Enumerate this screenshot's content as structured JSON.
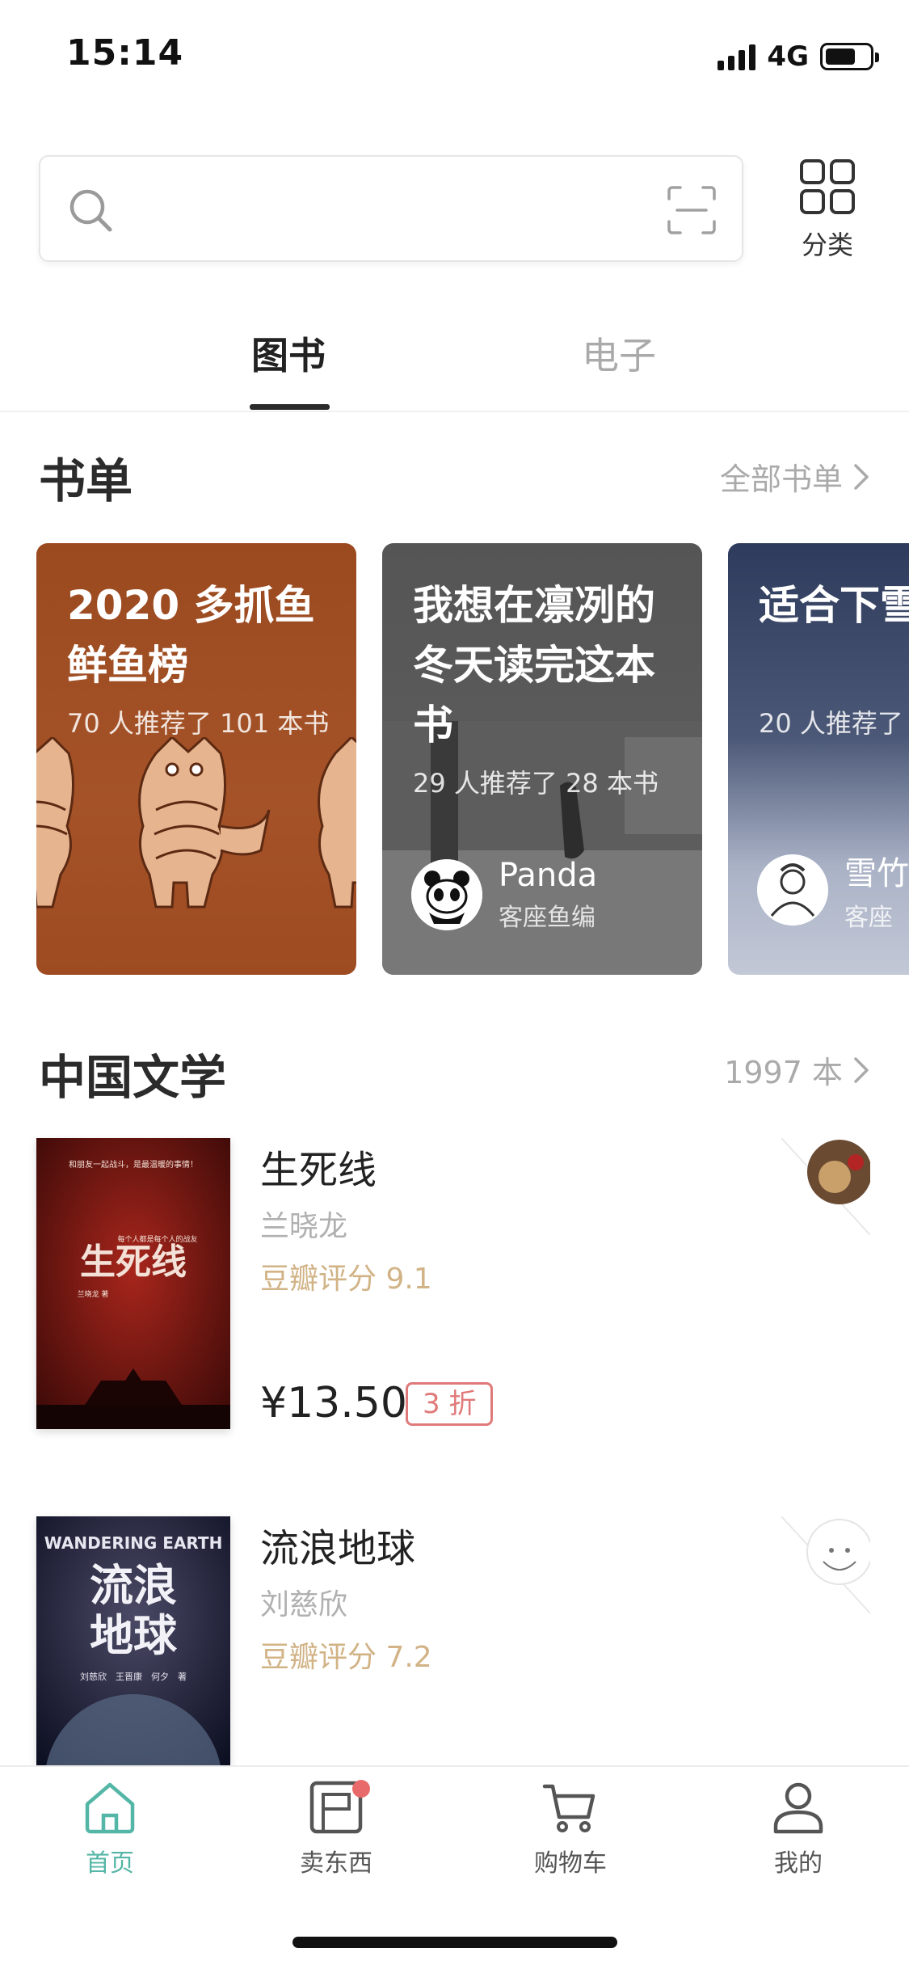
{
  "status": {
    "time": "15:14",
    "network": "4G"
  },
  "search": {
    "placeholder": ""
  },
  "category": {
    "label": "分类"
  },
  "tabs": [
    {
      "label": "图书",
      "active": true
    },
    {
      "label": "电子",
      "active": false
    }
  ],
  "booklist_section": {
    "title": "书单",
    "link": "全部书单"
  },
  "booklists": [
    {
      "title": "2020 多抓鱼鲜鱼榜",
      "subtitle": "70 人推荐了 101 本书"
    },
    {
      "title": "我想在凛冽的冬天读完这本书",
      "subtitle": "29 人推荐了 28 本书",
      "curator_name": "Panda",
      "curator_role": "客座鱼编"
    },
    {
      "title": "适合下雪的推理小",
      "subtitle": "20 人推荐了",
      "curator_name": "雪竹",
      "curator_role": "客座"
    }
  ],
  "literature_section": {
    "title": "中国文学",
    "count": "1997 本"
  },
  "books": [
    {
      "title": "生死线",
      "author": "兰晓龙",
      "rating": "豆瓣评分 9.1",
      "price": "¥13.50",
      "discount": "3 折",
      "cover_title": "生死线",
      "cover_top": "和朋友一起战斗，是最温暖的事情！",
      "cover_small": "每个人都是每个人的战友",
      "cover_author": "兰晓龙 著"
    },
    {
      "title": "流浪地球",
      "author": "刘慈欣",
      "rating": "豆瓣评分 7.2",
      "cover_title_1": "流浪",
      "cover_title_2": "地球",
      "cover_en": "WANDERING EARTH",
      "cover_authors": "刘慈欣　王晋康　何夕　著"
    }
  ],
  "nav": [
    {
      "label": "首页",
      "icon": "home-icon",
      "active": true
    },
    {
      "label": "卖东西",
      "icon": "sell-box-icon",
      "badge": true
    },
    {
      "label": "购物车",
      "icon": "cart-icon"
    },
    {
      "label": "我的",
      "icon": "profile-icon"
    }
  ],
  "colors": {
    "accent": "#54b6a6",
    "rating": "#d1b386",
    "discount": "#e07a7a"
  }
}
